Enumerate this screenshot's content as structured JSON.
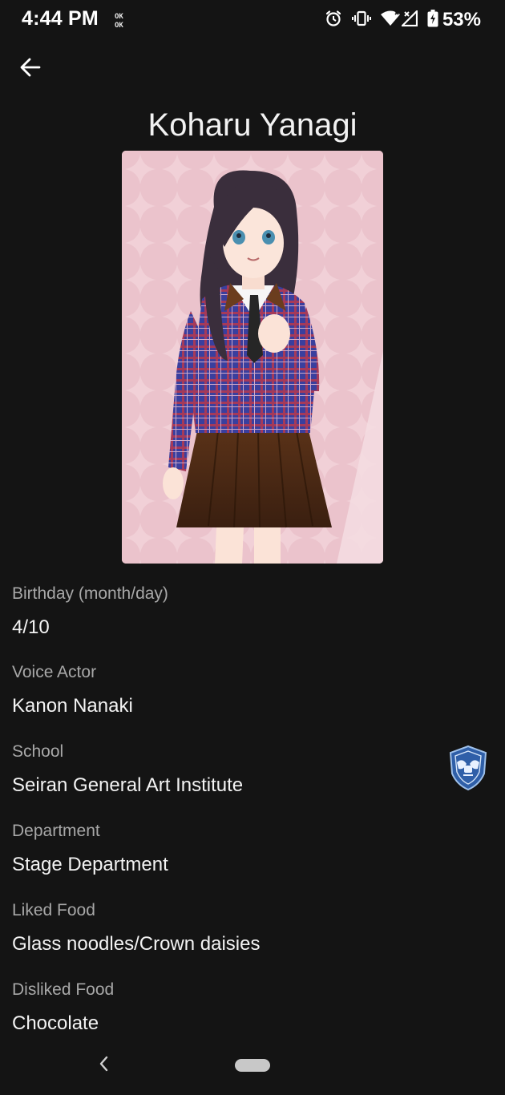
{
  "status_bar": {
    "time": "4:44 PM",
    "battery": "53%",
    "icons": [
      "ok-icon",
      "alarm-icon",
      "vibrate-icon",
      "wifi-icon",
      "signal-icon",
      "battery-charging-icon"
    ]
  },
  "header": {
    "back_icon": "arrow-left-icon",
    "title": "Koharu Yanagi"
  },
  "character_image": {
    "background_color": "#ebc3cc"
  },
  "details": [
    {
      "label": "Birthday (month/day)",
      "value": "4/10"
    },
    {
      "label": "Voice Actor",
      "value": "Kanon Nanaki"
    },
    {
      "label": "School",
      "value": "Seiran General Art Institute",
      "icon": "school-emblem-icon"
    },
    {
      "label": "Department",
      "value": "Stage Department"
    },
    {
      "label": "Liked Food",
      "value": "Glass noodles/Crown daisies"
    },
    {
      "label": "Disliked Food",
      "value": "Chocolate"
    }
  ],
  "nav_bar": {
    "back_icon": "chevron-left-icon",
    "home_icon": "home-pill-icon"
  },
  "colors": {
    "background": "#141414",
    "label": "#a8a8a8",
    "value": "#f3f3f3",
    "emblem": "#2f5fa8"
  }
}
